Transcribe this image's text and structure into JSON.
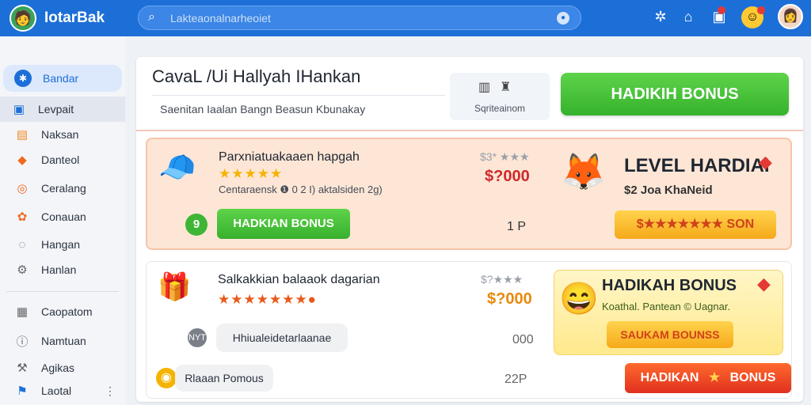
{
  "app": {
    "title": "IotarBak",
    "logo_icon": "avatar-icon"
  },
  "search": {
    "placeholder": "Lakteaonalnarheoiet"
  },
  "sidebar": {
    "items": [
      {
        "label": "Bandar",
        "icon": "✱"
      },
      {
        "label": "Levpait",
        "icon": "▣"
      },
      {
        "label": "Naksan",
        "icon": "▤"
      },
      {
        "label": "Danteol",
        "icon": "◆"
      },
      {
        "label": "Ceralang",
        "icon": "◎"
      },
      {
        "label": "Conauan",
        "icon": "✿"
      },
      {
        "label": "Hangan",
        "icon": "◌"
      },
      {
        "label": "Hanlan",
        "icon": "⚙"
      },
      {
        "label": "Caopatom",
        "icon": "▦"
      },
      {
        "label": "Namtuan",
        "icon": "ⓘ"
      },
      {
        "label": "Agikas",
        "icon": "⚒"
      },
      {
        "label": "Laotal",
        "icon": "⚑"
      }
    ]
  },
  "main": {
    "title": "CavaL /Ui Hallyah IHankan",
    "subtitle": "Saenitan Iaalan Bangn Beasun Kbunakay",
    "mini_panel_label": "Sqriteainom",
    "hero_button": "HADIKIH BONUS"
  },
  "card1": {
    "title": "Parxniatuakaaen hapgah",
    "stars": "★★★★★",
    "desc": "Centaraensk ❶ 0 2 I) aktalsiden 2g)",
    "number": "9",
    "button": "HADKIAN BONUS",
    "old_price": "$3* ★★★",
    "price": "$?000",
    "qty": "1 P",
    "level_title": "LEVEL HARDIAI",
    "level_sub": "$2 Joa KhaNeid",
    "level_button": "$★★★★★★★ SON"
  },
  "card2": {
    "title": "Salkakkian balaaok dagarian",
    "stars": "★★★★★★★●",
    "old_price": "$?★★★",
    "price": "$?000",
    "chip_text": "Hhiualeidetarlaanae",
    "qty": "000",
    "coin_chip": "Rlaaan Pomous",
    "qty2": "22P",
    "promo_title": "HADIKAH BONUS",
    "promo_desc": "Koathal. Pantean © Uagnar.",
    "promo_button": "SAUKAM BOUNSS",
    "red_button_left": "HADIKAN",
    "red_button_star": "★",
    "red_button_right": "BONUS"
  },
  "colors": {
    "accent": "#1d6fd8",
    "green": "#3fb535",
    "price_red": "#d0282a",
    "price_orange": "#e8890c"
  }
}
